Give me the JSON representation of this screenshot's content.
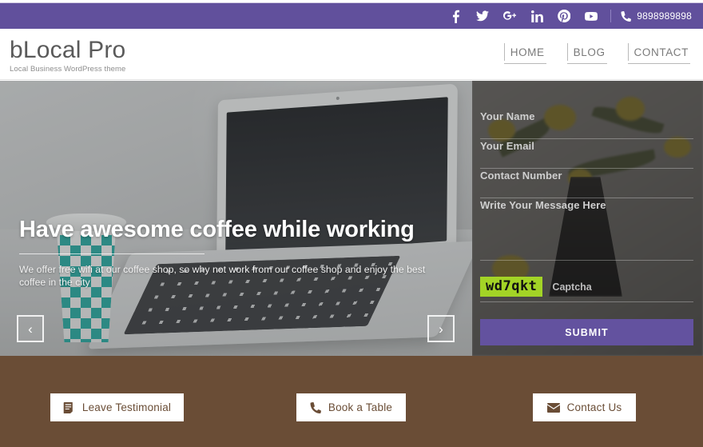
{
  "topbar": {
    "social": [
      {
        "name": "facebook-icon",
        "label": "Facebook"
      },
      {
        "name": "twitter-icon",
        "label": "Twitter"
      },
      {
        "name": "google-plus-icon",
        "label": "Google Plus"
      },
      {
        "name": "linkedin-icon",
        "label": "LinkedIn"
      },
      {
        "name": "pinterest-icon",
        "label": "Pinterest"
      },
      {
        "name": "youtube-icon",
        "label": "YouTube"
      }
    ],
    "phone": "9898989898",
    "background_color": "#61509c"
  },
  "header": {
    "brand_name": "bLocal Pro",
    "brand_tagline": "Local Business WordPress theme",
    "nav": [
      {
        "label": "HOME"
      },
      {
        "label": "BLOG"
      },
      {
        "label": "CONTACT"
      }
    ]
  },
  "hero": {
    "title": "Have awesome coffee while working",
    "description": "We offer free wifi at our coffee shop, so why not work from our coffee shop and enjoy the best coffee in the city",
    "prev_arrow": "‹",
    "next_arrow": "›"
  },
  "contact_form": {
    "fields": [
      {
        "placeholder": "Your Name",
        "value": ""
      },
      {
        "placeholder": "Your Email",
        "value": ""
      },
      {
        "placeholder": "Contact Number",
        "value": ""
      },
      {
        "placeholder": "Write Your Message Here",
        "value": ""
      }
    ],
    "captcha_code": "wd7qkt",
    "captcha_placeholder": "Captcha",
    "captcha_background": "#a3d426",
    "submit_label": "SUBMIT",
    "submit_color": "#63529f"
  },
  "cta": {
    "background_color": "#6a4d36",
    "buttons": [
      {
        "label": "Leave Testimonial",
        "icon": "book-icon"
      },
      {
        "label": "Book a Table",
        "icon": "phone-icon"
      },
      {
        "label": "Contact Us",
        "icon": "envelope-icon"
      }
    ]
  }
}
